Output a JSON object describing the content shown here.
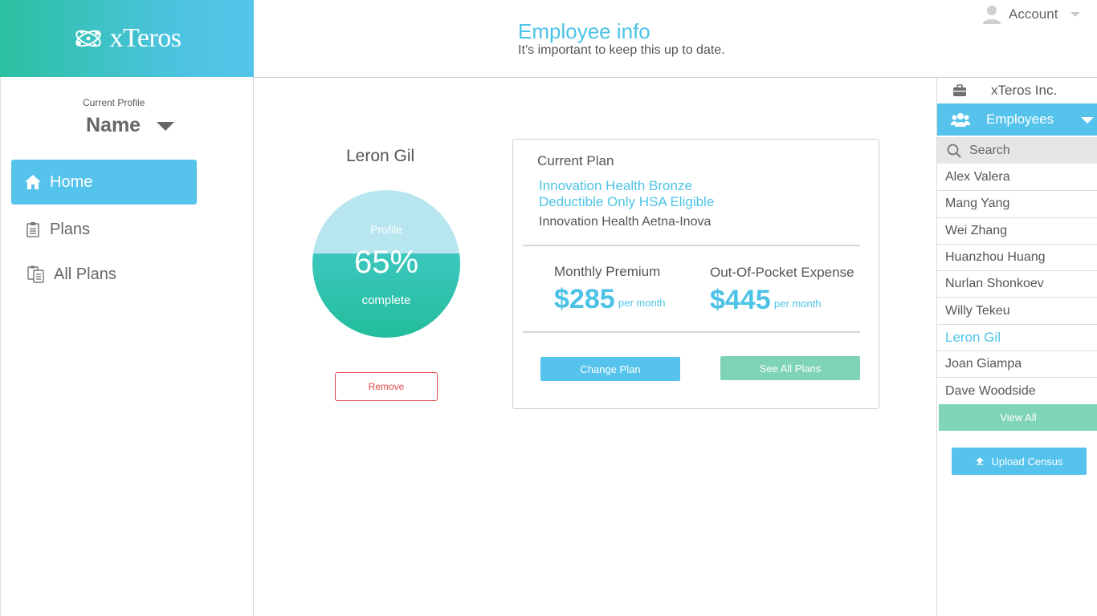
{
  "brand": {
    "name": "xTeros"
  },
  "header": {
    "title": "Employee info",
    "subtitle": "It’s important to keep this up to date.",
    "account_label": "Account"
  },
  "sidebar": {
    "profile_caption": "Current Profile",
    "profile_name": "Name",
    "items": [
      {
        "label": "Home",
        "icon": "home-icon",
        "active": true
      },
      {
        "label": "Plans",
        "icon": "clipboard-icon",
        "active": false
      },
      {
        "label": "All Plans",
        "icon": "clipboards-icon",
        "active": false
      }
    ]
  },
  "employee": {
    "name": "Leron Gil",
    "profile_progress": {
      "label_top": "Profile",
      "value": "65%",
      "label_bottom": "complete"
    },
    "remove_label": "Remove"
  },
  "plan": {
    "heading": "Current Plan",
    "name_line1": "Innovation Health Bronze",
    "name_line2": "Deductible Only HSA Eligible",
    "carrier": "Innovation Health Aetna-Inova",
    "monthly_premium": {
      "label": "Monthly Premium",
      "value": "$285",
      "unit": "per month"
    },
    "out_of_pocket": {
      "label": "Out-Of-Pocket Expense",
      "value": "$445",
      "unit": "per month"
    },
    "change_plan_label": "Change Plan",
    "see_all_plans_label": "See All Plans"
  },
  "right_panel": {
    "company": "xTeros Inc.",
    "employees_label": "Employees",
    "search_placeholder": "Search",
    "employees": [
      "Alex Valera",
      "Mang Yang",
      "Wei Zhang",
      "Huanzhou Huang",
      "Nurlan Shonkoev",
      "Willy Tekeu",
      "Leron Gil",
      "Joan Giampa",
      "Dave Woodside"
    ],
    "selected_employee": "Leron Gil",
    "view_all_label": "View All",
    "upload_label": "Upload Census"
  },
  "colors": {
    "accent_blue": "#55c3ec",
    "accent_green": "#7fd3b8",
    "danger": "#e04848",
    "brand_gradient_start": "#2bc0a0",
    "brand_gradient_end": "#55c4ea"
  }
}
